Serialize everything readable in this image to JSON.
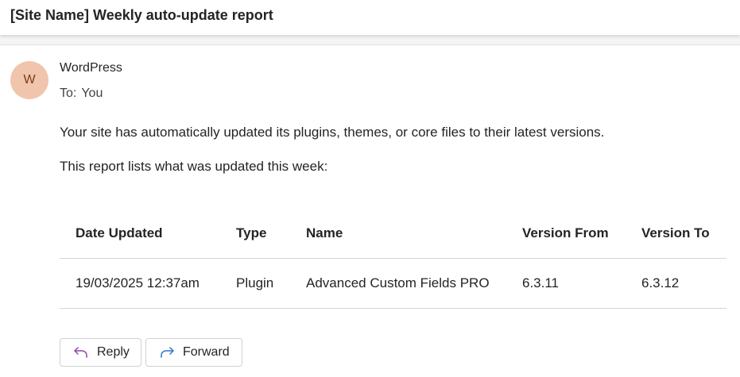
{
  "email": {
    "subject": "[Site Name] Weekly auto-update report",
    "sender": {
      "initial": "W",
      "name": "WordPress"
    },
    "to_label": "To:",
    "to_value": "You",
    "body": {
      "paragraph_1": "Your site has automatically updated its plugins, themes, or core files to their latest versions.",
      "paragraph_2": "This report lists what was updated this week:"
    },
    "table": {
      "headers": [
        "Date Updated",
        "Type",
        "Name",
        "Version From",
        "Version To"
      ],
      "rows": [
        [
          "19/03/2025 12:37am",
          "Plugin",
          "Advanced Custom Fields PRO",
          "6.3.11",
          "6.3.12"
        ]
      ]
    },
    "actions": {
      "reply_label": "Reply",
      "forward_label": "Forward"
    }
  },
  "colors": {
    "avatar_bg": "#f1c4ac",
    "avatar_text": "#7a3b1b",
    "reply_icon": "#8f45ad",
    "forward_icon": "#2a78c6"
  },
  "icons": {
    "reply": "reply-arrow-icon",
    "forward": "forward-arrow-icon"
  }
}
